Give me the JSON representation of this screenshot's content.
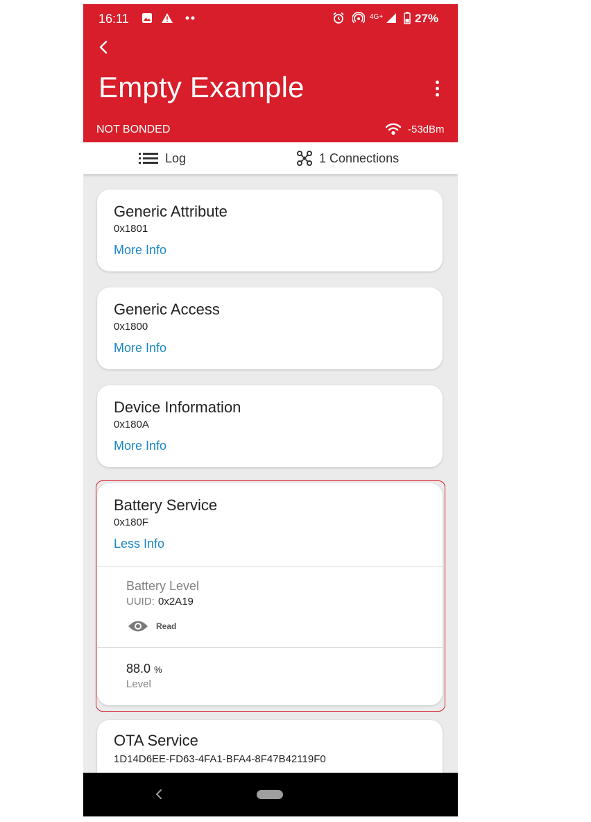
{
  "status_bar": {
    "time": "16:11",
    "network": "4G+",
    "battery_percent": "27%",
    "icons": [
      "image-icon",
      "alert-icon",
      "dots-icon",
      "alarm-icon",
      "hotspot-icon",
      "signal-icon",
      "battery-icon"
    ]
  },
  "header": {
    "title": "Empty Example",
    "bond_status": "NOT BONDED",
    "rssi": "-53dBm",
    "background_color": "#d81e2a"
  },
  "tabs": [
    {
      "label": "Log",
      "icon": "list-icon"
    },
    {
      "label": "1 Connections",
      "icon": "network-icon"
    }
  ],
  "services": [
    {
      "name": "Generic Attribute",
      "uuid": "0x1801",
      "toggle": "More Info"
    },
    {
      "name": "Generic Access",
      "uuid": "0x1800",
      "toggle": "More Info"
    },
    {
      "name": "Device Information",
      "uuid": "0x180A",
      "toggle": "More Info"
    },
    {
      "name": "Battery Service",
      "uuid": "0x180F",
      "toggle": "Less Info",
      "characteristic": {
        "name": "Battery Level",
        "uuid_label": "UUID:",
        "uuid": "0x2A19",
        "property": "Read",
        "value": "88.0",
        "unit": "%",
        "value_label": "Level"
      }
    },
    {
      "name": "OTA Service",
      "uuid": "1D14D6EE-FD63-4FA1-BFA4-8F47B42119F0"
    }
  ],
  "link_color": "#1a86c4"
}
